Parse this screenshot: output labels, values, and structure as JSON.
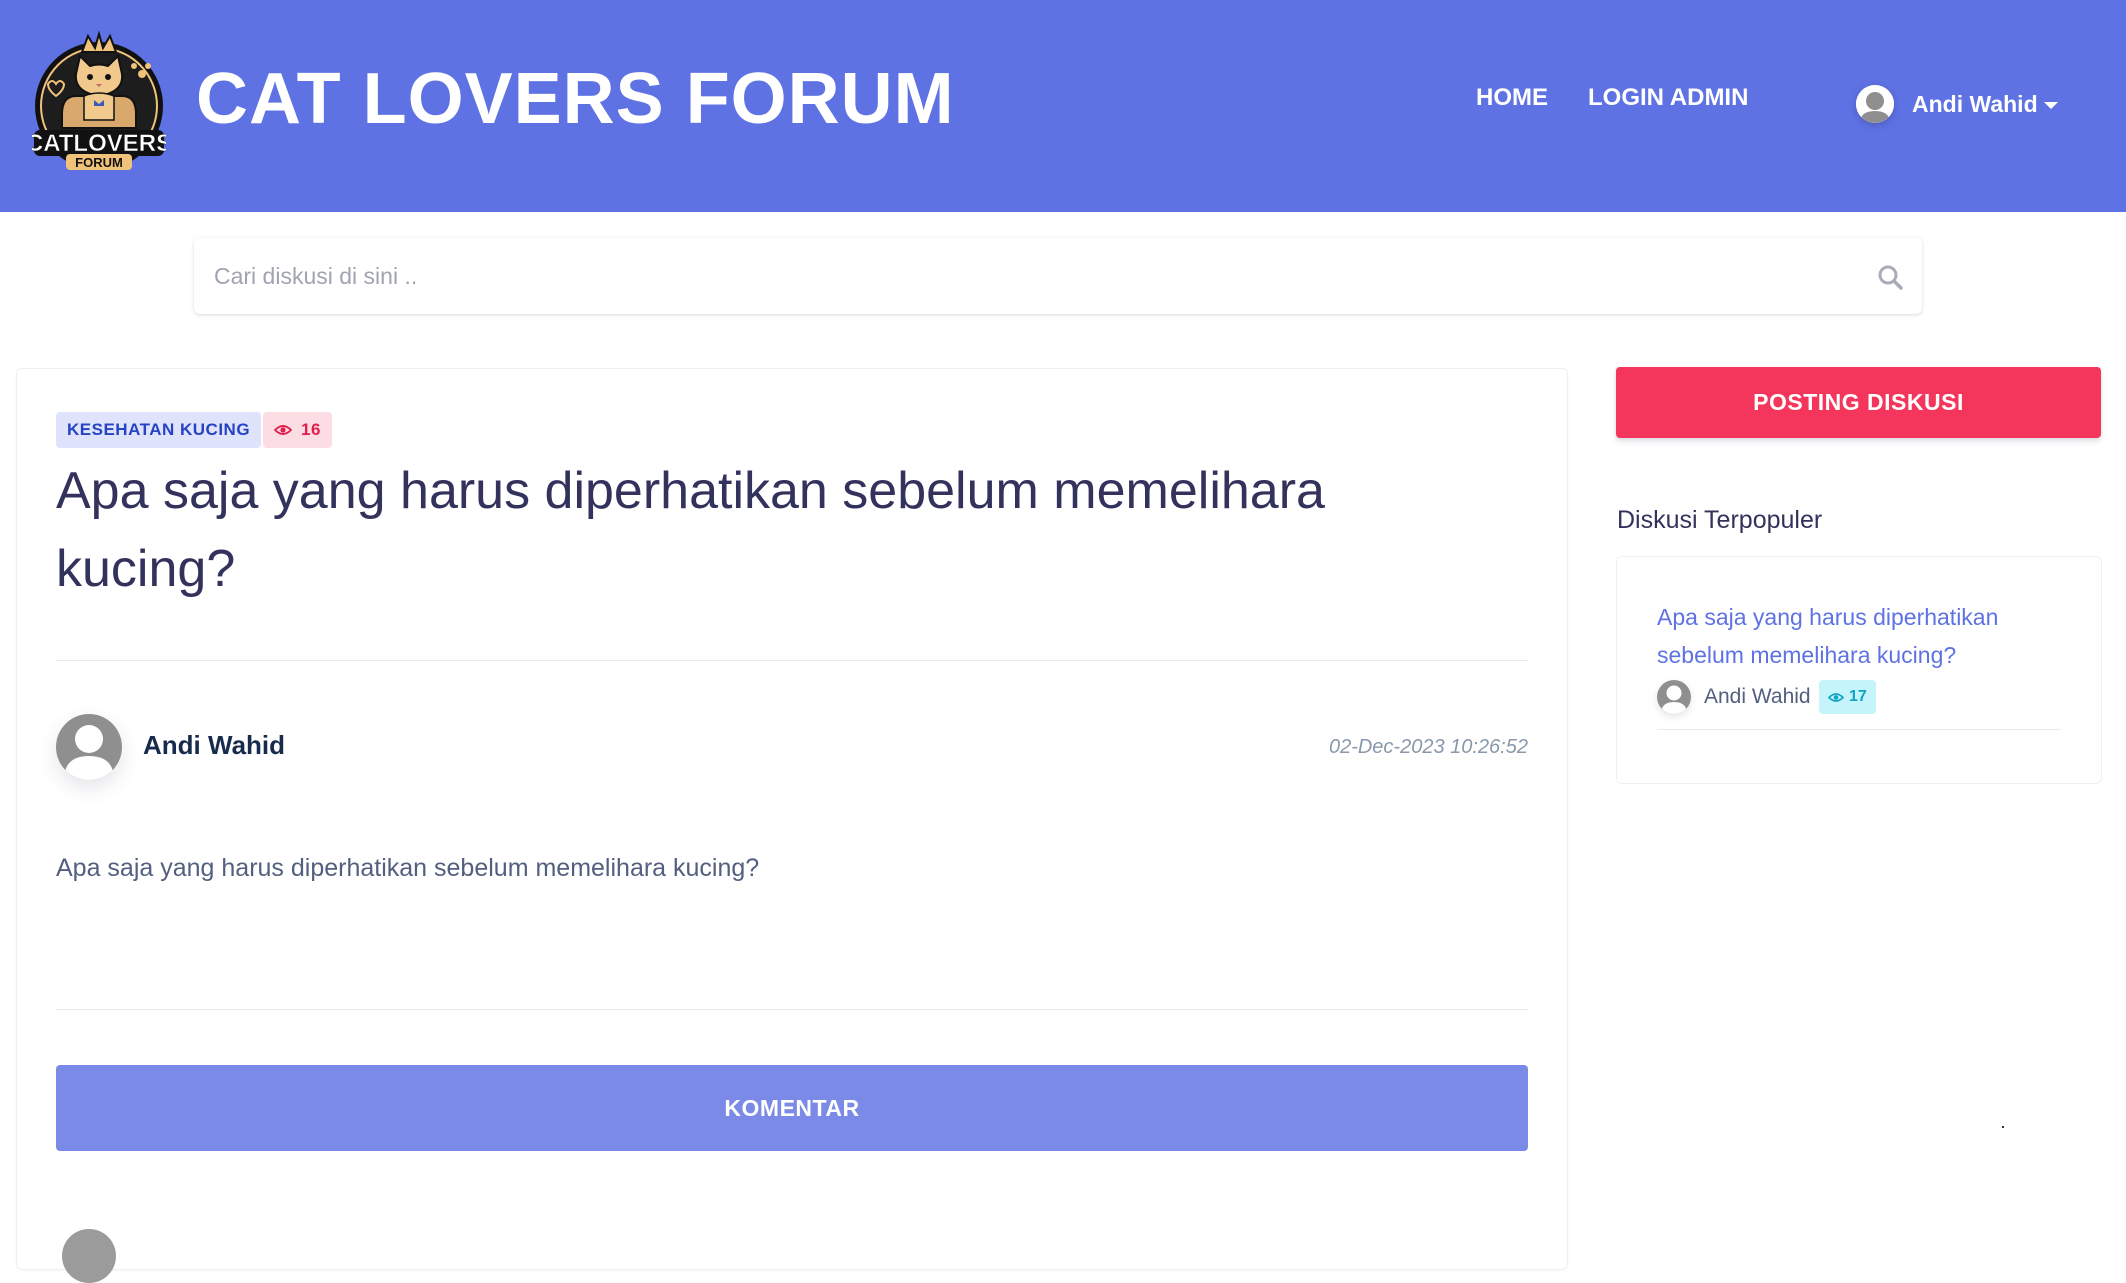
{
  "header": {
    "logo_text_line1": "CATLOVERS",
    "logo_text_line2": "FORUM",
    "brand": "CAT LOVERS FORUM",
    "nav": {
      "home": "HOME",
      "login_admin": "LOGIN ADMIN"
    },
    "user": {
      "name": "Andi Wahid",
      "icon": "chevron-down-icon"
    }
  },
  "search": {
    "placeholder": "Cari diskusi di sini ..",
    "value": "",
    "icon": "search-icon"
  },
  "post": {
    "category": "KESEHATAN KUCING",
    "views": "16",
    "title": "Apa saja yang harus diperhatikan sebelum memelihara kucing?",
    "author": "Andi Wahid",
    "date": "02-Dec-2023 10:26:52",
    "body": "Apa saja yang harus diperhatikan sebelum memelihara kucing?",
    "comment_button": "KOMENTAR"
  },
  "sidebar": {
    "post_button": "POSTING DISKUSI",
    "popular_heading": "Diskusi Terpopuler",
    "popular": [
      {
        "title": "Apa saja yang harus diperhatikan sebelum memelihara kucing?",
        "author": "Andi Wahid",
        "views": "17"
      }
    ]
  },
  "colors": {
    "primary": "#5e72e4",
    "danger": "#f5365c",
    "info": "#11cdef",
    "comment_button": "#7c8ae7"
  }
}
